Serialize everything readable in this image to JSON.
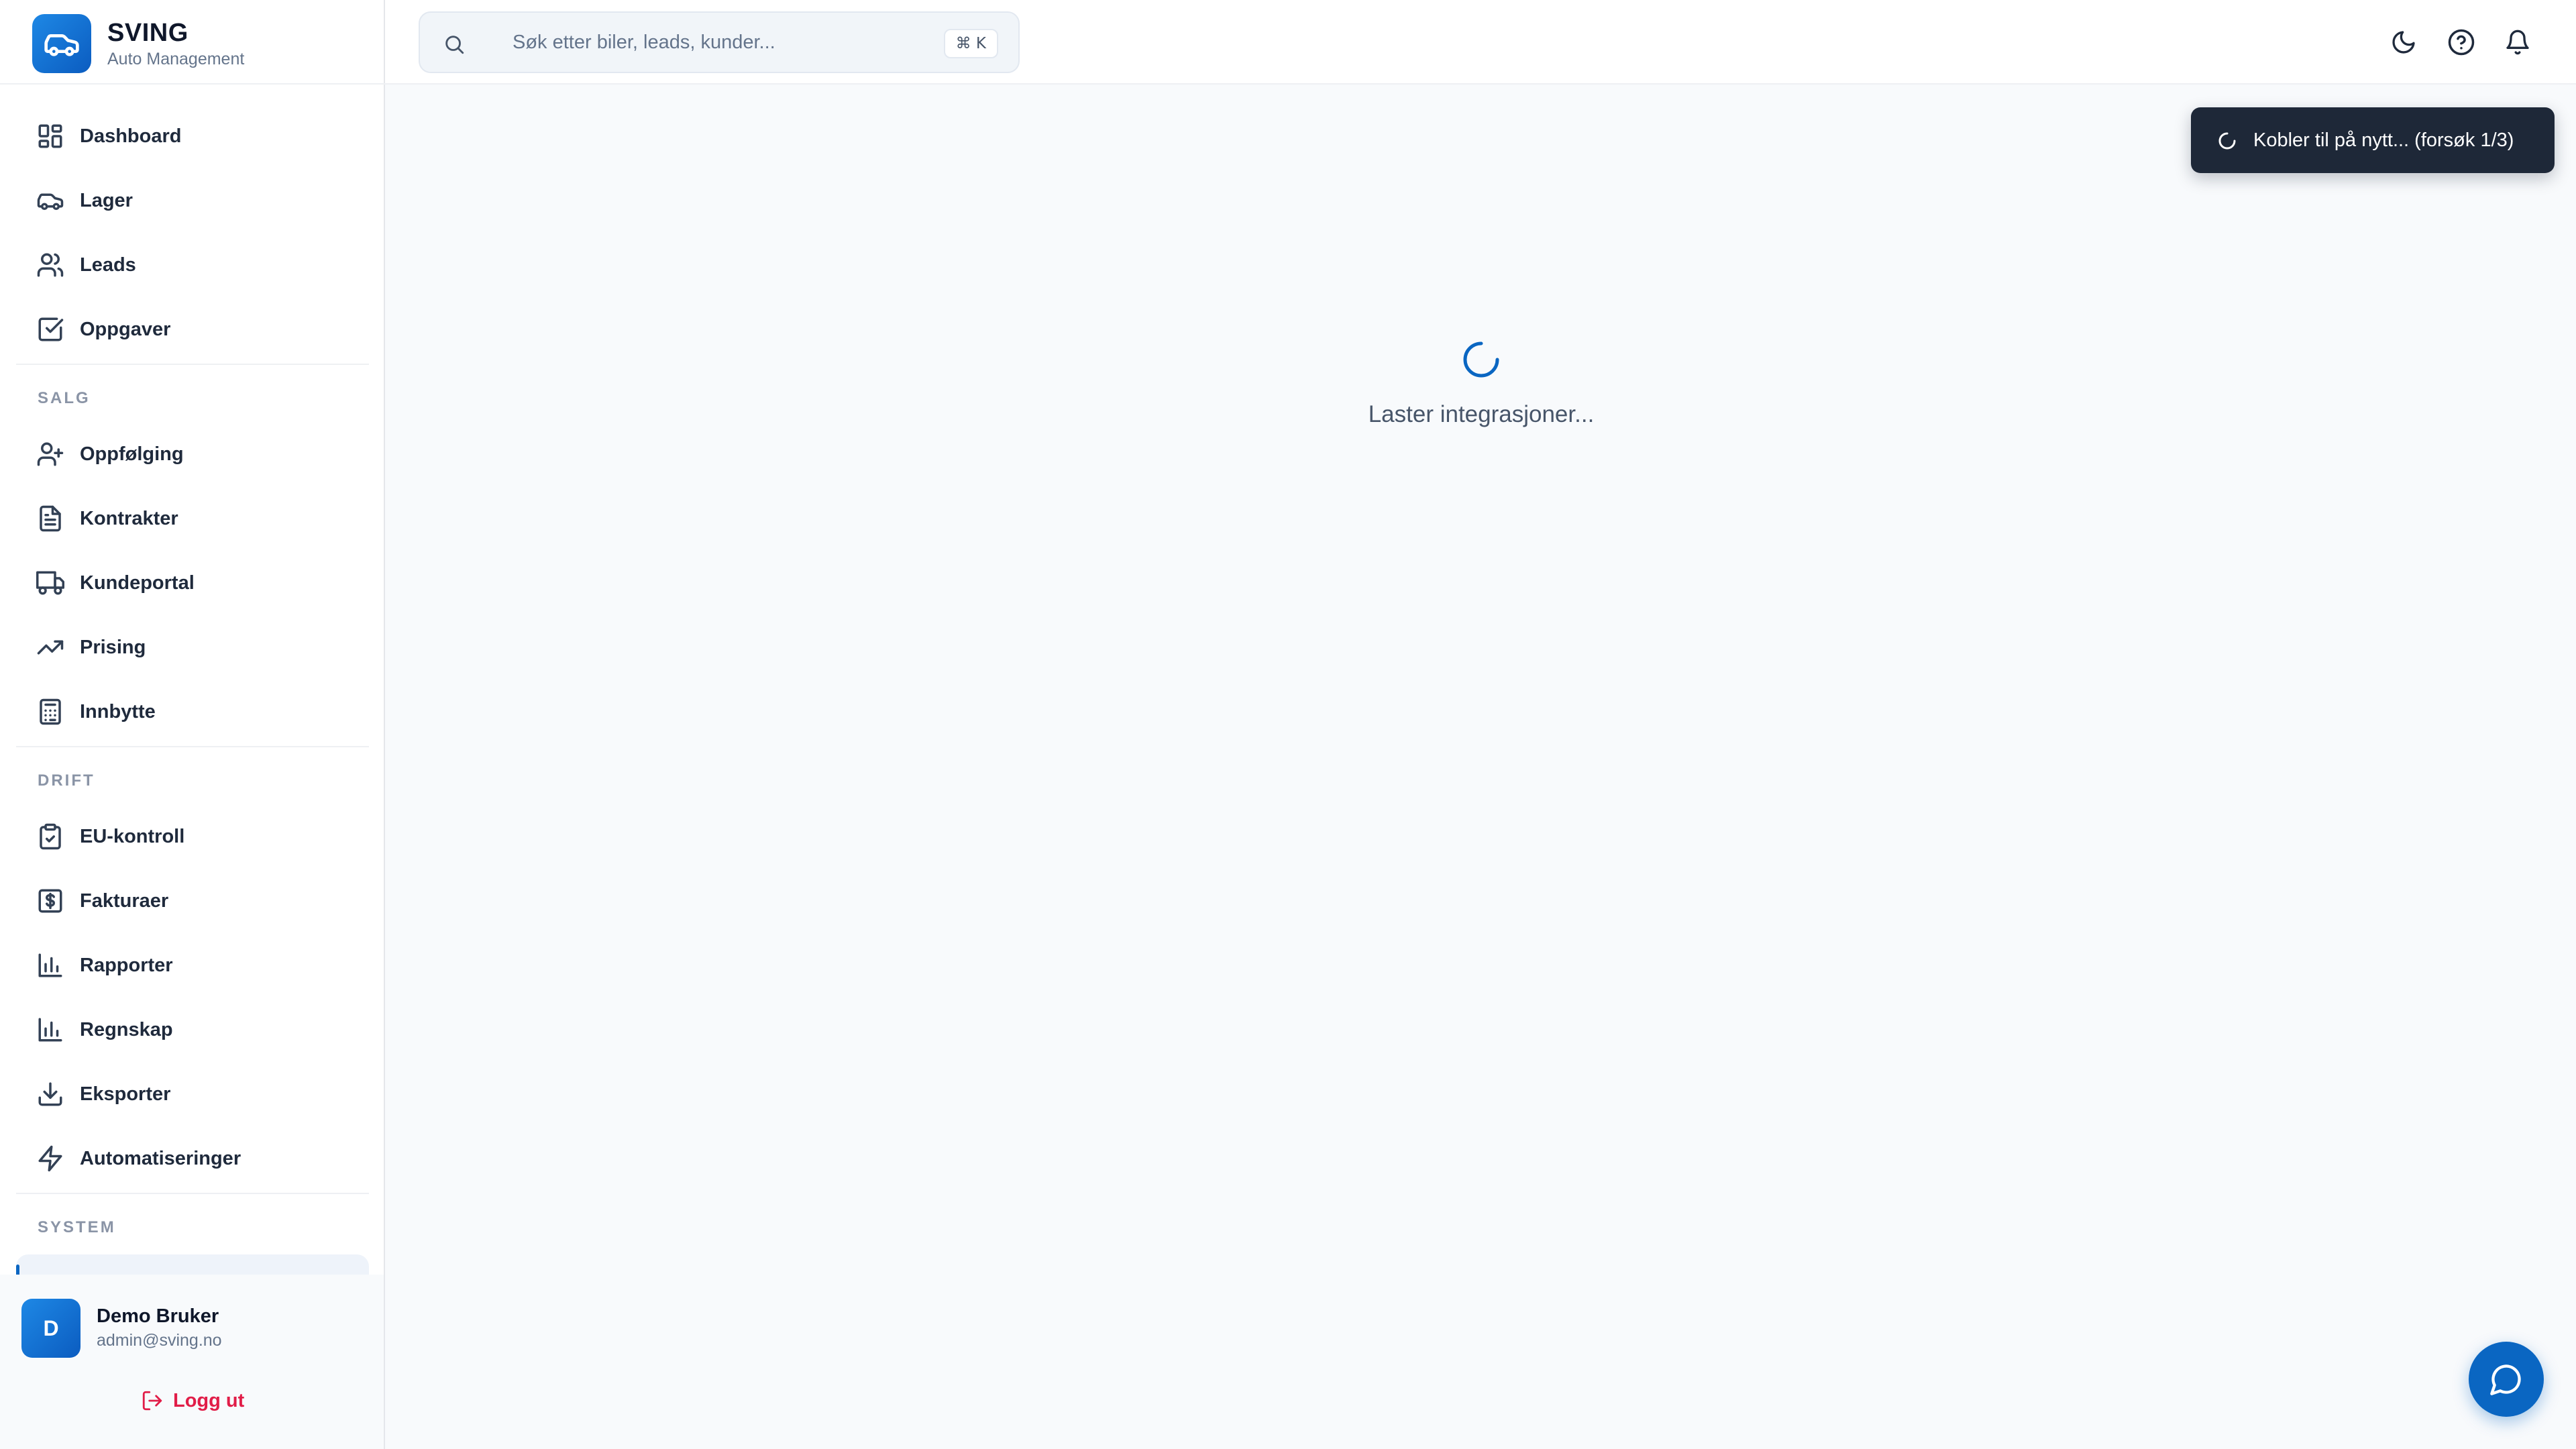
{
  "brand": {
    "name": "SVING",
    "subtitle": "Auto Management"
  },
  "nav": {
    "main": [
      {
        "label": "Dashboard",
        "icon": "dashboard-icon"
      },
      {
        "label": "Lager",
        "icon": "car-icon"
      },
      {
        "label": "Leads",
        "icon": "users-icon"
      },
      {
        "label": "Oppgaver",
        "icon": "checkbox-icon"
      }
    ],
    "salg": {
      "title": "SALG",
      "items": [
        {
          "label": "Oppfølging",
          "icon": "user-plus-icon"
        },
        {
          "label": "Kontrakter",
          "icon": "document-icon"
        },
        {
          "label": "Kundeportal",
          "icon": "truck-icon"
        },
        {
          "label": "Prising",
          "icon": "trending-up-icon"
        },
        {
          "label": "Innbytte",
          "icon": "calculator-icon"
        }
      ]
    },
    "drift": {
      "title": "DRIFT",
      "items": [
        {
          "label": "EU-kontroll",
          "icon": "clipboard-check-icon"
        },
        {
          "label": "Fakturaer",
          "icon": "dollar-receipt-icon"
        },
        {
          "label": "Rapporter",
          "icon": "bar-chart-icon"
        },
        {
          "label": "Regnskap",
          "icon": "bar-chart-icon"
        },
        {
          "label": "Eksporter",
          "icon": "download-icon"
        },
        {
          "label": "Automatiseringer",
          "icon": "lightning-icon"
        }
      ]
    },
    "system": {
      "title": "SYSTEM"
    }
  },
  "user": {
    "initial": "D",
    "name": "Demo Bruker",
    "email": "admin@sving.no",
    "logout_label": "Logg ut"
  },
  "header": {
    "search_placeholder": "Søk etter biler, leads, kunder...",
    "shortcut": "⌘ K"
  },
  "main": {
    "loading_text": "Laster integrasjoner..."
  },
  "toast": {
    "text": "Kobler til på nytt... (forsøk 1/3)"
  },
  "colors": {
    "accent": "#0a66c2",
    "logout": "#e11d48",
    "toast_bg": "#1e2838",
    "sidebar_text": "#1f2a3c",
    "muted": "#64748b"
  }
}
